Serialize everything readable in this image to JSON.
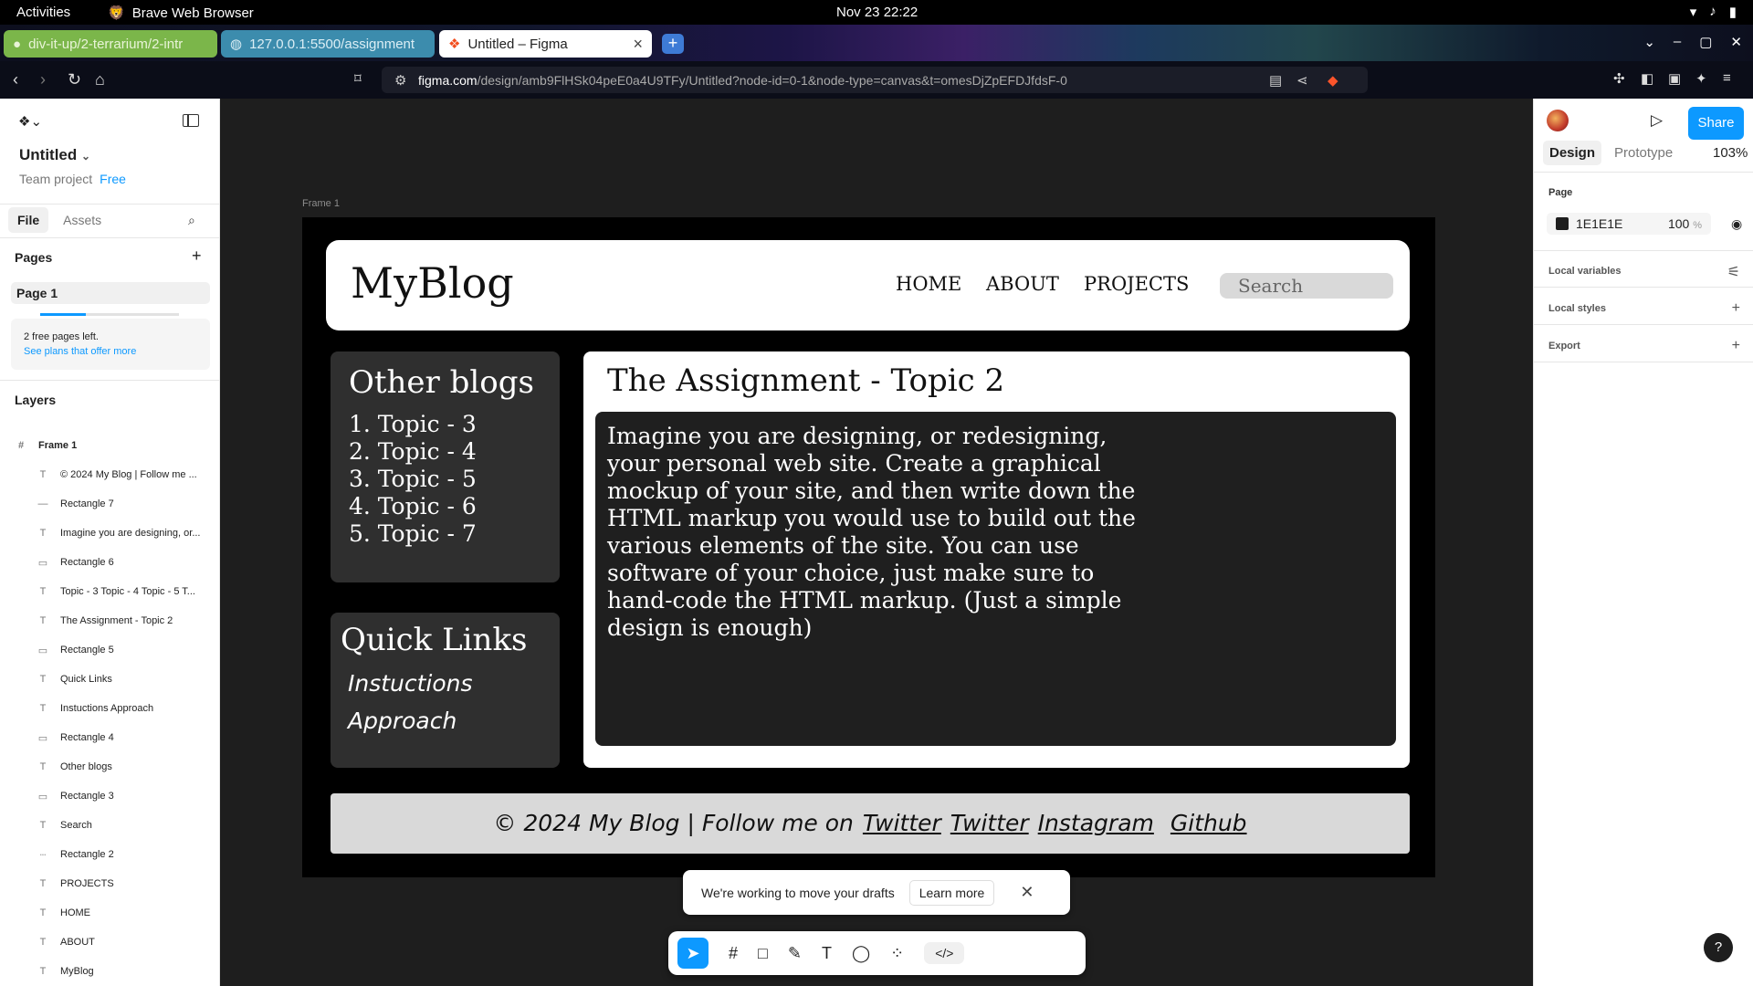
{
  "os": {
    "activities": "Activities",
    "app_name": "Brave Web Browser",
    "clock": "Nov 23  22:22"
  },
  "browser": {
    "tabs": [
      {
        "label": "div-it-up/2-terrarium/2-intr"
      },
      {
        "label": "127.0.0.1:5500/assignment"
      },
      {
        "label": "Untitled – Figma"
      }
    ],
    "url_host": "figma.com",
    "url_path": "/design/amb9FlHSk04peE0a4U9TFy/Untitled?node-id=0-1&node-type=canvas&t=omesDjZpEFDJfdsF-0"
  },
  "figma": {
    "file_title": "Untitled",
    "team": "Team project",
    "plan": "Free",
    "file_tab": "File",
    "assets_tab": "Assets",
    "pages_header": "Pages",
    "page_name": "Page 1",
    "free_pages_text": "2 free pages left.",
    "free_pages_link": "See plans that offer more",
    "free_pages_progress": 0.33,
    "layers_header": "Layers",
    "layers": [
      {
        "name": "Frame 1",
        "icon": "#"
      },
      {
        "name": "© 2024 My Blog | Follow me ...",
        "icon": "T"
      },
      {
        "name": "Rectangle 7",
        "icon": "—"
      },
      {
        "name": "Imagine you are designing, or...",
        "icon": "T"
      },
      {
        "name": "Rectangle 6",
        "icon": "▭"
      },
      {
        "name": "Topic - 3 Topic - 4 Topic - 5 T...",
        "icon": "T"
      },
      {
        "name": "The Assignment - Topic 2",
        "icon": "T"
      },
      {
        "name": "Rectangle 5",
        "icon": "▭"
      },
      {
        "name": "Quick Links",
        "icon": "T"
      },
      {
        "name": "Instuctions Approach",
        "icon": "T"
      },
      {
        "name": "Rectangle 4",
        "icon": "▭"
      },
      {
        "name": "Other blogs",
        "icon": "T"
      },
      {
        "name": "Rectangle 3",
        "icon": "▭"
      },
      {
        "name": "Search",
        "icon": "T"
      },
      {
        "name": "Rectangle 2",
        "icon": "┈"
      },
      {
        "name": "PROJECTS",
        "icon": "T"
      },
      {
        "name": "HOME",
        "icon": "T"
      },
      {
        "name": "ABOUT",
        "icon": "T"
      },
      {
        "name": "MyBlog",
        "icon": "T"
      }
    ],
    "frame_label": "Frame 1",
    "toast_text": "We're working to move your drafts",
    "toast_learn": "Learn more",
    "design_tab": "Design",
    "prototype_tab": "Prototype",
    "zoom": "103%",
    "share": "Share",
    "page_section": "Page",
    "page_color": "1E1E1E",
    "page_opacity": "100",
    "page_opacity_unit": "%",
    "local_variables": "Local variables",
    "local_styles": "Local styles",
    "export": "Export",
    "accent_color": "#0d99ff"
  },
  "mockup": {
    "logo": "MyBlog",
    "nav": [
      "HOME",
      "ABOUT",
      "PROJECTS"
    ],
    "search": "Search",
    "other_blogs_title": "Other blogs",
    "other_blogs": [
      "1. Topic - 3",
      "2. Topic - 4",
      "3. Topic - 5",
      "4. Topic - 6",
      "5. Topic - 7"
    ],
    "quick_links_title": "Quick Links",
    "quick_links": [
      "Instuctions",
      "Approach"
    ],
    "main_title": "The Assignment - Topic 2",
    "main_body": "Imagine you are designing, or redesigning, your personal web site. Create a graphical mockup of your site, and then write down the HTML markup you would use to build out the various elements of the site. You can use software of your choice, just make sure to hand-code the HTML markup. (Just a simple design is enough)",
    "footer_prefix": "© 2024 My Blog | Follow me on",
    "footer_links": [
      "Twitter",
      "Twitter",
      "Instagram",
      "Github"
    ]
  }
}
